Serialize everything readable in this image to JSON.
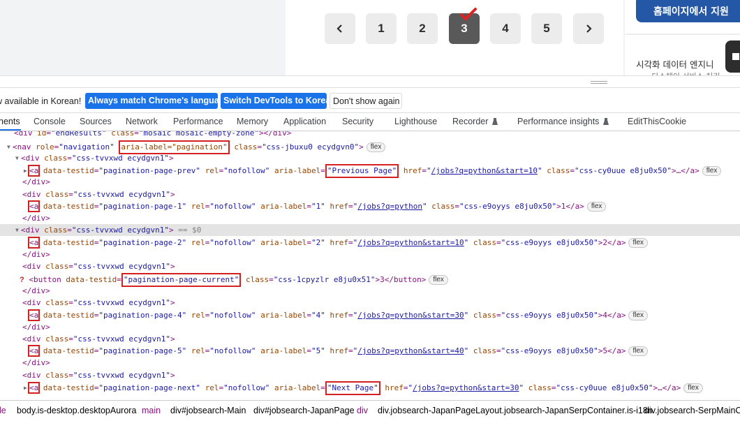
{
  "pagination": {
    "prev_icon": "chevron-left-icon",
    "next_icon": "chevron-right-icon",
    "pages": [
      "1",
      "2",
      "3",
      "4",
      "5"
    ],
    "current_page": "3"
  },
  "sidebar": {
    "apply_button": "홈페이지에서 지원",
    "job_title": "시각화 데이터 엔지니",
    "job_sub": "- 다스체이 서비스 처리"
  },
  "infobar": {
    "message": "w available in Korean!",
    "btn_match": "Always match Chrome's language",
    "btn_switch": "Switch DevTools to Korean",
    "btn_dismiss": "Don't show again"
  },
  "tabs": [
    "nents",
    "Console",
    "Sources",
    "Network",
    "Performance",
    "Memory",
    "Application",
    "Security",
    "Lighthouse",
    "Recorder",
    "Performance insights",
    "EditThisCookie"
  ],
  "tree": {
    "l0": {
      "tag_open": "<div ",
      "a1": "id",
      "v1": "\"endResults\"",
      "a2": "class",
      "v2": "\"mosaic mosaic-empty-zone\"",
      "tag_close": "></div>"
    },
    "l1": {
      "tag_open": "<nav ",
      "a1": "role",
      "v1": "\"navigation\"",
      "hl_attr": "aria-label=\"pagination\"",
      "a3": "class",
      "v3": "\"css-jbuxu0 ecydgvn0\"",
      "tag_close": ">",
      "badge": "flex"
    },
    "div_open": "<div ",
    "div_class_attr": "class",
    "div_class_val": "\"css-tvvxwd ecydgvn1\"",
    "div_close": "</div>",
    "gt": ">",
    "a_tag": "<a",
    "testid_attr": "data-testid",
    "rel": "rel",
    "rel_val": "\"nofollow\"",
    "aria": "aria-label",
    "href": "href",
    "cls": "class",
    "eq": "=",
    "q": "\"",
    "ellipsis": ">…</a>",
    "selected_hint": " == $0",
    "prev": {
      "testid": "\"pagination-page-prev\"",
      "label": "\"Previous Page\"",
      "link": "/jobs?q=python&start=10",
      "class_val": "\"css-cy0uue e8ju0x50\"",
      "badge": "flex"
    },
    "p1": {
      "testid": "\"pagination-page-1\"",
      "label": "\"1\"",
      "link": "/jobs?q=python",
      "class_val": "\"css-e9oyys e8ju0x50\"",
      "text": ">1</a>",
      "badge": "flex"
    },
    "p2": {
      "testid": "\"pagination-page-2\"",
      "label": "\"2\"",
      "link": "/jobs?q=python&start=10",
      "class_val": "\"css-e9oyys e8ju0x50\"",
      "text": ">2</a>",
      "badge": "flex"
    },
    "cur": {
      "qmark": "?",
      "tag": "<button ",
      "testid_attr": "data-testid",
      "testid_hl": "\"pagination-page-current\"",
      "class_val": "\"css-1cpyzlr e8ju0x51\"",
      "text": ">3</button>",
      "badge": "flex"
    },
    "p4": {
      "testid": "\"pagination-page-4\"",
      "label": "\"4\"",
      "link": "/jobs?q=python&start=30",
      "class_val": "\"css-e9oyys e8ju0x50\"",
      "text": ">4</a>",
      "badge": "flex"
    },
    "p5": {
      "testid": "\"pagination-page-5\"",
      "label": "\"5\"",
      "link": "/jobs?q=python&start=40",
      "class_val": "\"css-e9oyys e8ju0x50\"",
      "text": ">5</a>",
      "badge": "flex"
    },
    "next": {
      "testid": "\"pagination-page-next\"",
      "label": "\"Next Page\"",
      "link": "/jobs?q=python&start=30",
      "class_val": "\"css-cy0uue e8ju0x50\"",
      "badge": "flex"
    }
  },
  "breadcrumbs": {
    "c0": "le",
    "c1_tag": "body",
    "c1_cls": ".is-desktop.desktopAurora",
    "c2_tag": "main",
    "c3_tag": "div",
    "c3_cls": "#jobsearch-Main",
    "c4_tag": "div",
    "c4_cls": "#jobsearch-JapanPage",
    "c5_tag": "div",
    "c6_tag": "div",
    "c6_cls": ".jobsearch-JapanPageLayout.jobsearch-JapanSerpContainer.is-i18n",
    "c7_tag": "div",
    "c7_cls": ".jobsearch-SerpMainCo"
  },
  "colors": {
    "accent": "#1a73e8",
    "tag": "#881280",
    "attr": "#994500",
    "value": "#1a1aa6",
    "highlight_box": "#d32020",
    "apply_blue": "#2557a7"
  }
}
